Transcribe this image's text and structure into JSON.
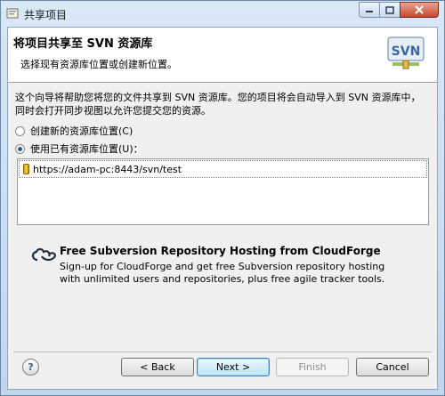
{
  "window": {
    "title": "共享项目"
  },
  "header": {
    "title": "将项目共享至 SVN 资源库",
    "description": "选择现有资源库位置或创建新位置。",
    "logo_text": "SVN"
  },
  "intro": {
    "line1": "这个向导将帮助您将您的文件共享到 SVN 资源库。您的项目将会自动导入到 SVN 资源库中，",
    "line2": "同时会打开同步视图以允许您提交您的资源。"
  },
  "options": [
    {
      "label": "创建新的资源库位置(C)",
      "checked": false
    },
    {
      "label": "使用已有资源库位置(U)：",
      "checked": true
    }
  ],
  "repositories": [
    {
      "url": "https://adam-pc:8443/svn/test",
      "icon": "repository-icon"
    }
  ],
  "cloudforge": {
    "title": "Free Subversion Repository Hosting from CloudForge",
    "line1": "Sign-up for CloudForge and get free Subversion repository hosting",
    "line2": "with unlimited users and repositories, plus free agile tracker tools."
  },
  "buttons": {
    "help": "?",
    "back": "< Back",
    "next": "Next >",
    "finish": "Finish",
    "cancel": "Cancel"
  }
}
